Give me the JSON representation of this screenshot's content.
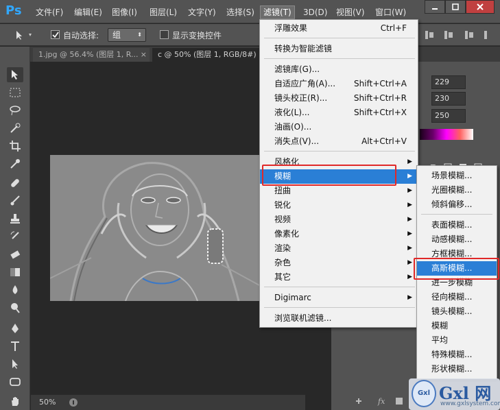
{
  "menubar": {
    "logo": "Ps",
    "items": [
      "文件(F)",
      "编辑(E)",
      "图像(I)",
      "图层(L)",
      "文字(Y)",
      "选择(S)",
      "滤镜(T)",
      "3D(D)",
      "视图(V)",
      "窗口(W)"
    ],
    "active_index": 6
  },
  "options": {
    "auto_select_label": "自动选择:",
    "auto_select_value": "组",
    "show_transform_label": "显示变换控件"
  },
  "tabs": [
    {
      "label": "1.jpg @ 56.4% (图层 1, R...",
      "close": "×"
    },
    {
      "label": "c @ 50% (图层 1, RGB/8#)",
      "close": "×"
    }
  ],
  "status": {
    "zoom": "50%"
  },
  "color_values": [
    "229",
    "230",
    "250"
  ],
  "filter_menu": {
    "items": [
      {
        "label": "浮雕效果",
        "shortcut": "Ctrl+F"
      },
      {
        "label": "转换为智能滤镜",
        "shortcut": ""
      },
      {
        "label": "滤镜库(G)...",
        "shortcut": ""
      },
      {
        "label": "自适应广角(A)...",
        "shortcut": "Shift+Ctrl+A"
      },
      {
        "label": "镜头校正(R)...",
        "shortcut": "Shift+Ctrl+R"
      },
      {
        "label": "液化(L)...",
        "shortcut": "Shift+Ctrl+X"
      },
      {
        "label": "油画(O)...",
        "shortcut": ""
      },
      {
        "label": "消失点(V)...",
        "shortcut": "Alt+Ctrl+V"
      },
      {
        "label": "风格化",
        "shortcut": ""
      },
      {
        "label": "模糊",
        "shortcut": ""
      },
      {
        "label": "扭曲",
        "shortcut": ""
      },
      {
        "label": "锐化",
        "shortcut": ""
      },
      {
        "label": "视频",
        "shortcut": ""
      },
      {
        "label": "像素化",
        "shortcut": ""
      },
      {
        "label": "渲染",
        "shortcut": ""
      },
      {
        "label": "杂色",
        "shortcut": ""
      },
      {
        "label": "其它",
        "shortcut": ""
      },
      {
        "label": "Digimarc",
        "shortcut": ""
      },
      {
        "label": "浏览联机滤镜...",
        "shortcut": ""
      }
    ]
  },
  "blur_submenu": {
    "items": [
      "场景模糊...",
      "光圈模糊...",
      "倾斜偏移...",
      "表面模糊...",
      "动感模糊...",
      "方框模糊...",
      "高斯模糊...",
      "进一步模糊",
      "径向模糊...",
      "镜头模糊...",
      "模糊",
      "平均",
      "特殊模糊...",
      "形状模糊..."
    ]
  },
  "watermark": {
    "text": "Gxl 网",
    "url": "www.gxlsystem.com",
    "logo": "Gxl"
  }
}
